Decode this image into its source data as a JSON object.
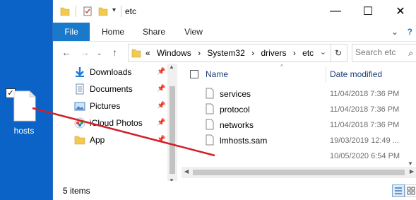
{
  "desktop": {
    "file_label": "hosts",
    "checkbox_mark": "✓"
  },
  "window": {
    "title": "etc",
    "controls": {
      "minimize": "—",
      "maximize": "☐",
      "close": "✕"
    }
  },
  "ribbon": {
    "tabs": [
      "File",
      "Home",
      "Share",
      "View"
    ],
    "expand": "⌄",
    "help": "?"
  },
  "address": {
    "overflow": "«",
    "crumbs": [
      "Windows",
      "System32",
      "drivers",
      "etc"
    ],
    "separator": "›",
    "dropdown": "⌄",
    "refresh": "↻"
  },
  "search": {
    "placeholder": "Search etc",
    "icon": "⌕"
  },
  "nav": {
    "items": [
      {
        "label": "Downloads",
        "icon": "download-arrow-icon",
        "pinned": true
      },
      {
        "label": "Documents",
        "icon": "documents-icon",
        "pinned": true
      },
      {
        "label": "Pictures",
        "icon": "pictures-icon",
        "pinned": true
      },
      {
        "label": "iCloud Photos",
        "icon": "icloud-photos-icon",
        "pinned": true
      },
      {
        "label": "App",
        "icon": "folder-icon",
        "pinned": true
      }
    ]
  },
  "columns": {
    "name": "Name",
    "date_modified": "Date modified"
  },
  "files": [
    {
      "name": "services",
      "date": "11/04/2018 7:36 PM"
    },
    {
      "name": "protocol",
      "date": "11/04/2018 7:36 PM"
    },
    {
      "name": "networks",
      "date": "11/04/2018 7:36 PM"
    },
    {
      "name": "lmhosts.sam",
      "date": "19/03/2019 12:49 ..."
    },
    {
      "name": "",
      "date": "10/05/2020 6:54 PM"
    }
  ],
  "status": {
    "items_count": "5 items"
  },
  "colors": {
    "desktop_bg": "#0b63c8",
    "file_tab": "#1979ca",
    "annotation_line": "#d0202a",
    "folder_yellow": "#f3c94e"
  }
}
